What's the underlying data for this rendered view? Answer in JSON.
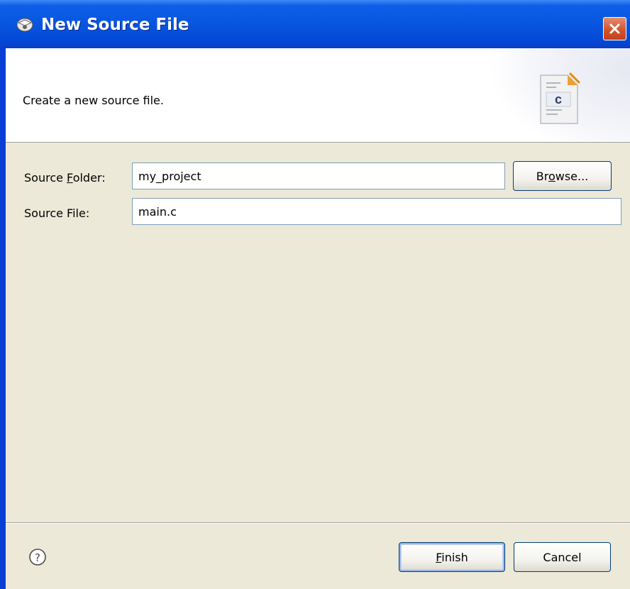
{
  "window": {
    "title": "New Source File",
    "title_icon": "eclipse-wizard-icon",
    "close_icon": "close-icon"
  },
  "banner": {
    "description": "Create a new source file.",
    "icon": "c-source-file-icon",
    "icon_letter": "c"
  },
  "form": {
    "source_folder": {
      "label_before": "Source ",
      "label_mnemonic": "F",
      "label_after": "older:",
      "value": "my_project"
    },
    "browse": {
      "label_before": "Br",
      "label_mnemonic": "o",
      "label_after": "wse..."
    },
    "source_file": {
      "label": "Source File:",
      "value": "main.c"
    }
  },
  "footer": {
    "help_icon": "help-icon",
    "finish": {
      "mnemonic": "F",
      "rest": "inish"
    },
    "cancel": "Cancel"
  },
  "colors": {
    "titlebar": "#0756e0",
    "dialog_bg": "#ece9d8",
    "close_button": "#d3542f"
  }
}
